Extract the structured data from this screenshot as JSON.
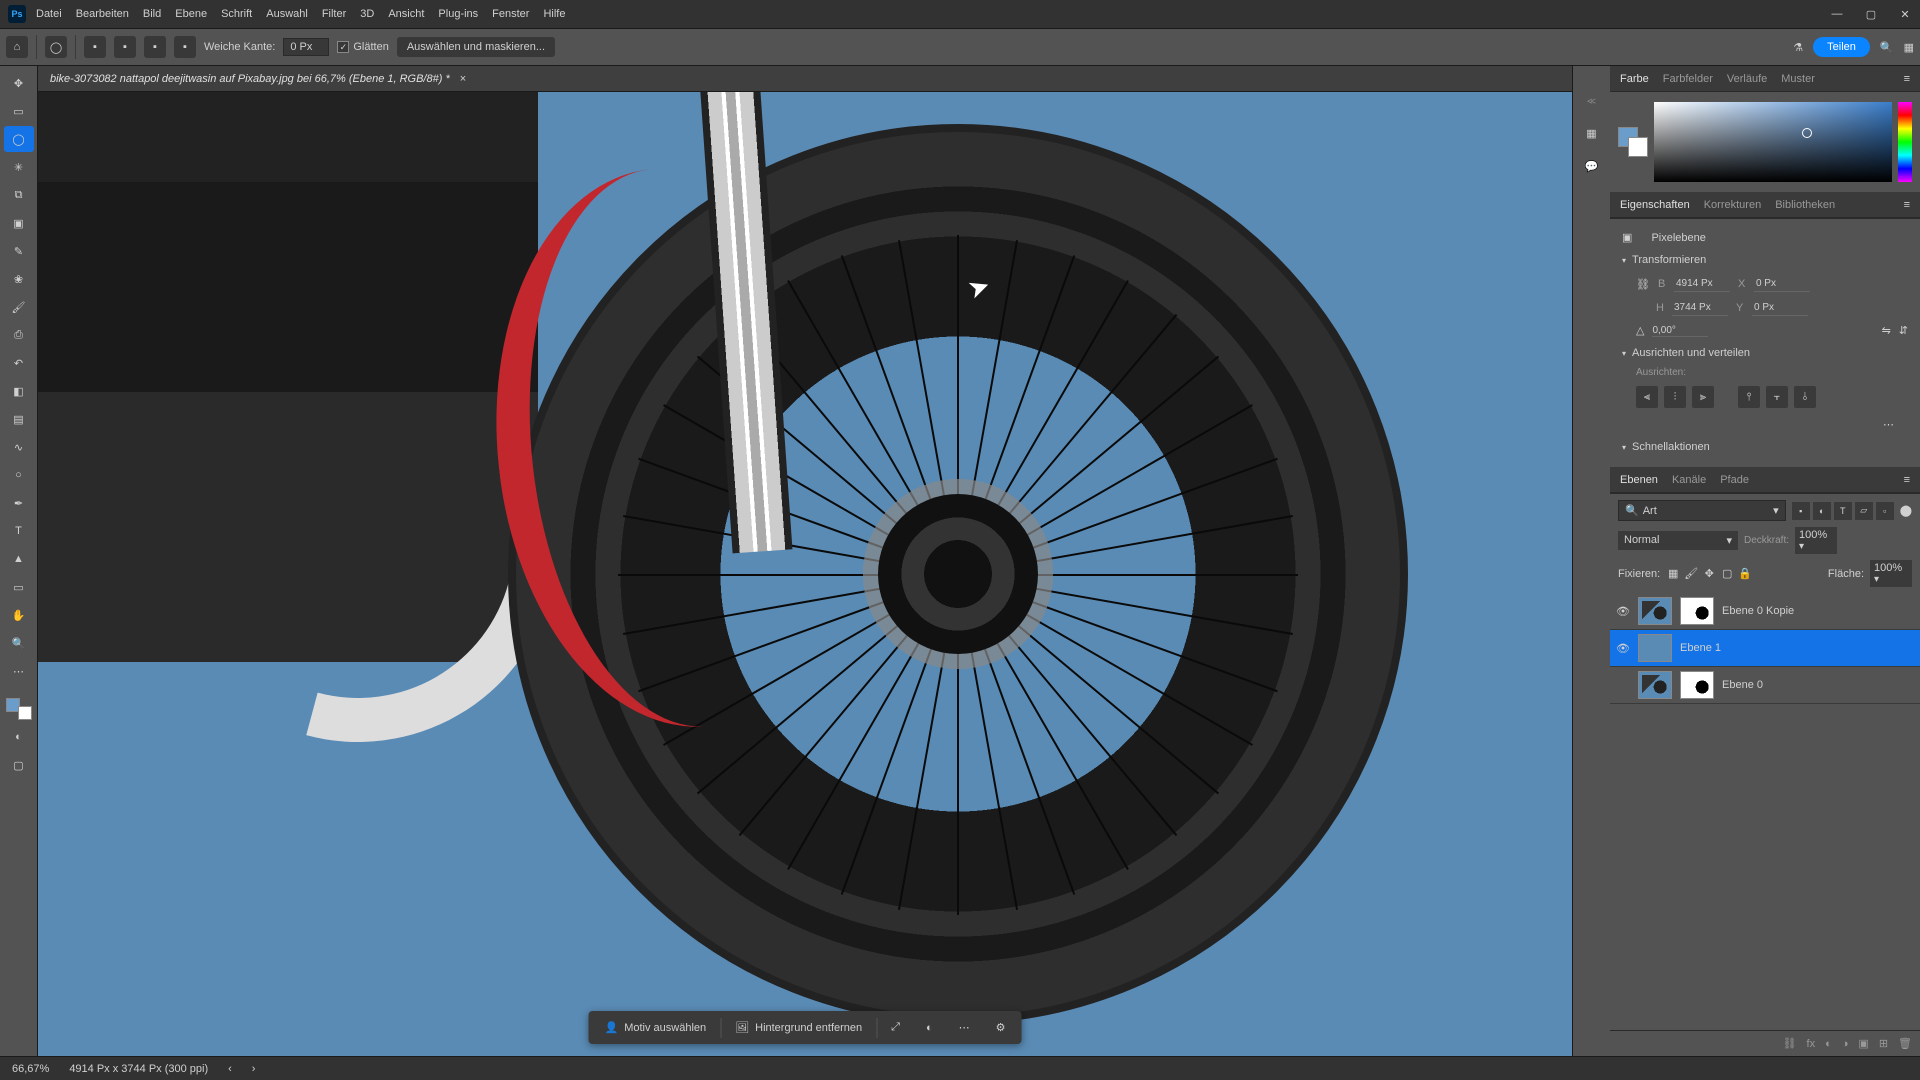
{
  "menu": {
    "items": [
      "Datei",
      "Bearbeiten",
      "Bild",
      "Ebene",
      "Schrift",
      "Auswahl",
      "Filter",
      "3D",
      "Ansicht",
      "Plug-ins",
      "Fenster",
      "Hilfe"
    ]
  },
  "window": {
    "minimize": "—",
    "maximize": "▢",
    "close": "✕"
  },
  "options": {
    "weiche_kante_label": "Weiche Kante:",
    "weiche_kante_value": "0 Px",
    "glaetten": "Glätten",
    "select_mask": "Auswählen und maskieren...",
    "share": "Teilen"
  },
  "document": {
    "tab_title": "bike-3073082 nattapol deejitwasin auf Pixabay.jpg bei 66,7% (Ebene 1, RGB/8#) *",
    "close": "×"
  },
  "context_bar": {
    "select_subject": "Motiv auswählen",
    "remove_bg": "Hintergrund entfernen"
  },
  "panels": {
    "color_tabs": [
      "Farbe",
      "Farbfelder",
      "Verläufe",
      "Muster"
    ],
    "props_tabs": [
      "Eigenschaften",
      "Korrekturen",
      "Bibliotheken"
    ],
    "layers_tabs": [
      "Ebenen",
      "Kanäle",
      "Pfade"
    ],
    "pixel_layer": "Pixelebene",
    "transform_head": "Transformieren",
    "transform": {
      "B": "4914 Px",
      "H": "3744 Px",
      "X": "0 Px",
      "Y": "0 Px",
      "angle": "0,00°"
    },
    "align_head": "Ausrichten und verteilen",
    "align_label": "Ausrichten:",
    "quick_head": "Schnellaktionen"
  },
  "layers": {
    "search_placeholder": "Art",
    "blend_mode": "Normal",
    "opacity_label": "Deckkraft:",
    "opacity": "100%",
    "fixieren": "Fixieren:",
    "fill_label": "Fläche:",
    "fill": "100%",
    "items": [
      {
        "name": "Ebene 0 Kopie",
        "visible": true,
        "hasMask": true,
        "selected": false
      },
      {
        "name": "Ebene 1",
        "visible": true,
        "hasMask": false,
        "selected": true
      },
      {
        "name": "Ebene 0",
        "visible": false,
        "hasMask": true,
        "selected": false
      }
    ]
  },
  "status": {
    "zoom": "66,67%",
    "doc_info": "4914 Px x 3744 Px (300 ppi)"
  }
}
